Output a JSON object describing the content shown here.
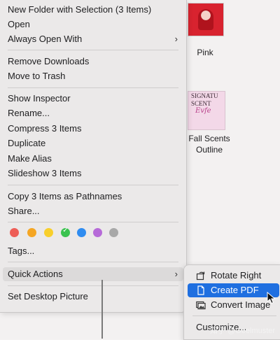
{
  "desktop": {
    "files": [
      {
        "name": "Pink",
        "kind": "image"
      },
      {
        "name": "Fall Scents Outline",
        "name_line1": "Fall Scents",
        "name_line2": "Outline",
        "doc_text_line1": "SIGNATU",
        "doc_text_line2": "SCENT",
        "doc_script": "Evfe"
      }
    ]
  },
  "context_menu": {
    "group1": [
      "New Folder with Selection (3 Items)",
      "Open",
      "Always Open With"
    ],
    "group2": [
      "Remove Downloads",
      "Move to Trash"
    ],
    "group3": [
      "Show Inspector",
      "Rename...",
      "Compress 3 Items",
      "Duplicate",
      "Make Alias",
      "Slideshow 3 Items"
    ],
    "group4": [
      "Copy 3 Items as Pathnames",
      "Share..."
    ],
    "tag_colors": [
      "#ee5e57",
      "#f5a623",
      "#f8cf2c",
      "#3bc24f",
      "#2f8cf0",
      "#b66ad8",
      "#a8a8a8"
    ],
    "tags_label": "Tags...",
    "quick_actions": "Quick Actions",
    "set_desktop": "Set Desktop Picture",
    "submenu_chevron": "›"
  },
  "quick_actions_submenu": {
    "items": [
      {
        "label": "Rotate Right",
        "icon": "rotate-right-icon"
      },
      {
        "label": "Create PDF",
        "icon": "document-icon",
        "highlighted": true
      },
      {
        "label": "Convert Image",
        "icon": "image-icon"
      }
    ],
    "customize": "Customize..."
  },
  "watermark": "知乎 @Geelmuster"
}
